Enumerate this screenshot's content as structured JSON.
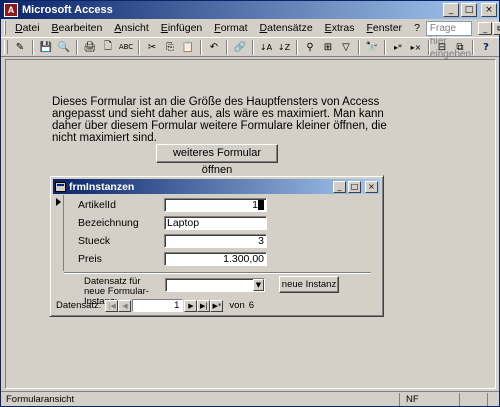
{
  "app": {
    "title": "Microsoft Access",
    "icon_label": "A"
  },
  "window_controls": {
    "minimize": "_",
    "maximize": "□",
    "close": "×"
  },
  "menubar": {
    "items": [
      "Datei",
      "Bearbeiten",
      "Ansicht",
      "Einfügen",
      "Format",
      "Datensätze",
      "Extras",
      "Fenster",
      "?"
    ],
    "help_placeholder": "Frage hier eingeben",
    "doc_controls": {
      "minimize": "_",
      "restore": "⧉",
      "close": "×"
    }
  },
  "toolbar": {
    "icons": [
      "design-view-icon",
      "save-icon",
      "search-icon",
      "print-icon",
      "print-preview-icon",
      "spellcheck-icon",
      "cut-icon",
      "copy-icon",
      "paste-icon",
      "undo-icon",
      "hyperlink-icon",
      "sort-asc-icon",
      "sort-desc-icon",
      "filter-selection-icon",
      "filter-form-icon",
      "apply-filter-icon",
      "find-icon",
      "new-record-icon",
      "delete-record-icon",
      "database-window-icon",
      "new-object-icon",
      "help-icon"
    ],
    "glyphs": [
      "✎",
      "💾",
      "🔍",
      "🖨",
      "🗋",
      "ABC",
      "✂",
      "⎘",
      "📋",
      "↶",
      "🔗",
      "↓A",
      "↓Z",
      "⚲",
      "⊞",
      "▽",
      "🔭",
      "▸*",
      "▸×",
      "⊟",
      "⧉",
      "?"
    ]
  },
  "main": {
    "info_text": "Dieses Formular ist an die Größe des Hauptfensters von Access angepasst und sieht daher aus, als wäre es maximiert. Man kann daher über diesem Formular weitere Formulare kleiner öffnen, die nicht maximiert sind.",
    "open_form_button": "weiteres Formular öffnen"
  },
  "child_form": {
    "title": "frmInstanzen",
    "controls": {
      "minimize": "_",
      "maximize": "□",
      "close": "×"
    },
    "fields": [
      {
        "label": "ArtikelId",
        "value": "1"
      },
      {
        "label": "Bezeichnung",
        "value": "Laptop"
      },
      {
        "label": "Stueck",
        "value": "3"
      },
      {
        "label": "Preis",
        "value": "1.300,00"
      }
    ],
    "footer": {
      "label": "Datensatz für neue Formular-Instanz:",
      "combo_value": "",
      "button": "neue Instanz"
    },
    "navigation": {
      "label": "Datensatz:",
      "current": "1",
      "of_label": "von",
      "total": "6",
      "buttons": {
        "first": "|◀",
        "prev": "◀",
        "next": "▶",
        "last": "▶|",
        "new": "▶*"
      }
    }
  },
  "statusbar": {
    "text": "Formularansicht",
    "mode": "NF"
  }
}
